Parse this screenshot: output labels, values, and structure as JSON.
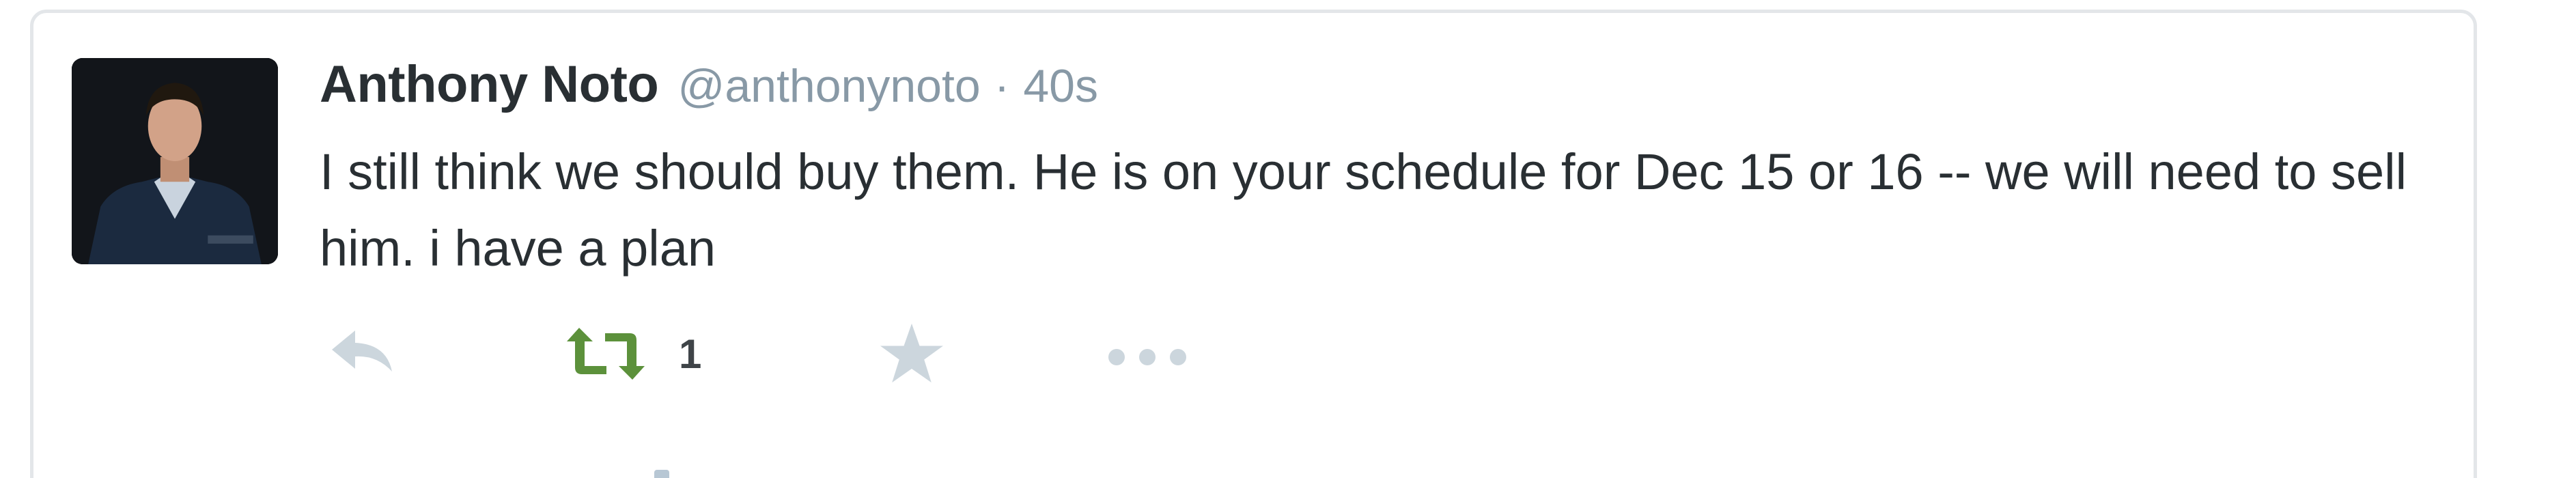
{
  "tweet": {
    "author_name": "Anthony Noto",
    "author_handle": "@anthonynoto",
    "meta_separator": "·",
    "timestamp": "40s",
    "text": "I still think we should buy them. He is on your schedule for Dec 15 or 16 -- we will need to sell him. i have a plan"
  },
  "actions": {
    "reply_icon": "reply-icon",
    "retweet_icon": "retweet-icon",
    "retweet_count": "1",
    "favorite_icon": "star-icon",
    "more_icon": "more-icon"
  },
  "colors": {
    "name": "#292f33",
    "meta": "#8899a6",
    "icon_inactive": "#ccd6dd",
    "retweeted": "#5c913b",
    "card_border": "#e3e6e9"
  }
}
